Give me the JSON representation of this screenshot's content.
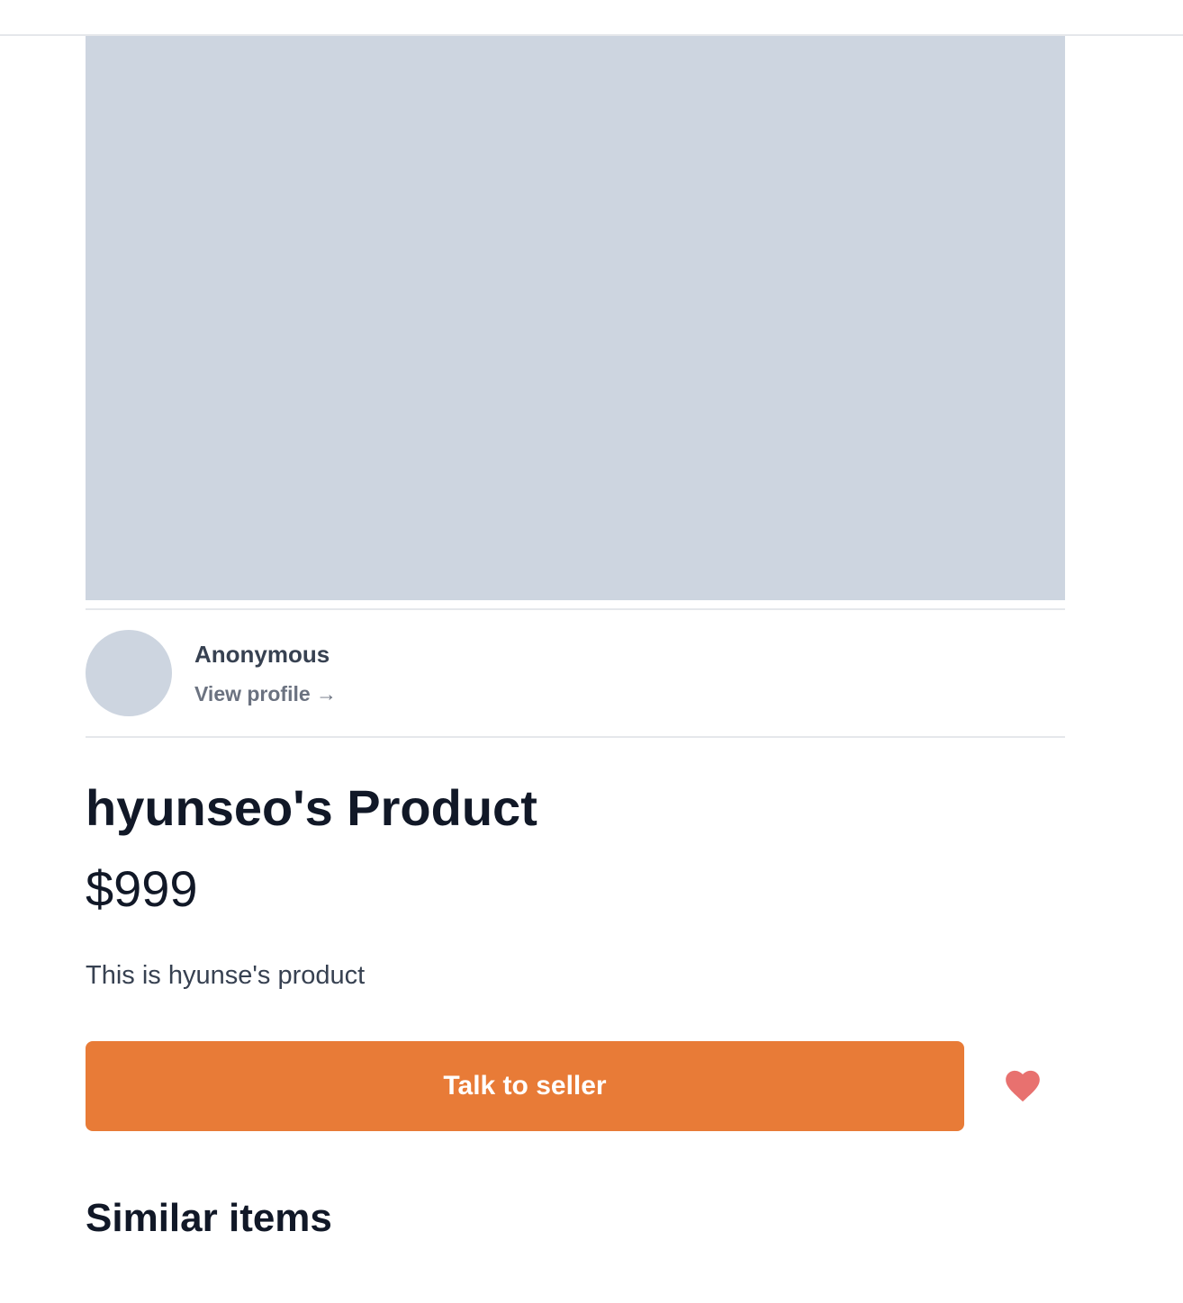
{
  "seller": {
    "name": "Anonymous",
    "view_profile_label": "View profile →"
  },
  "product": {
    "title": "hyunseo's Product",
    "price": "$999",
    "description": "This is hyunse's product"
  },
  "actions": {
    "talk_label": "Talk to seller",
    "favorite_icon": "heart-icon"
  },
  "similar": {
    "heading": "Similar items"
  },
  "colors": {
    "accent": "#e87b37",
    "heart": "#e8716f",
    "placeholder": "#cdd5e0"
  }
}
